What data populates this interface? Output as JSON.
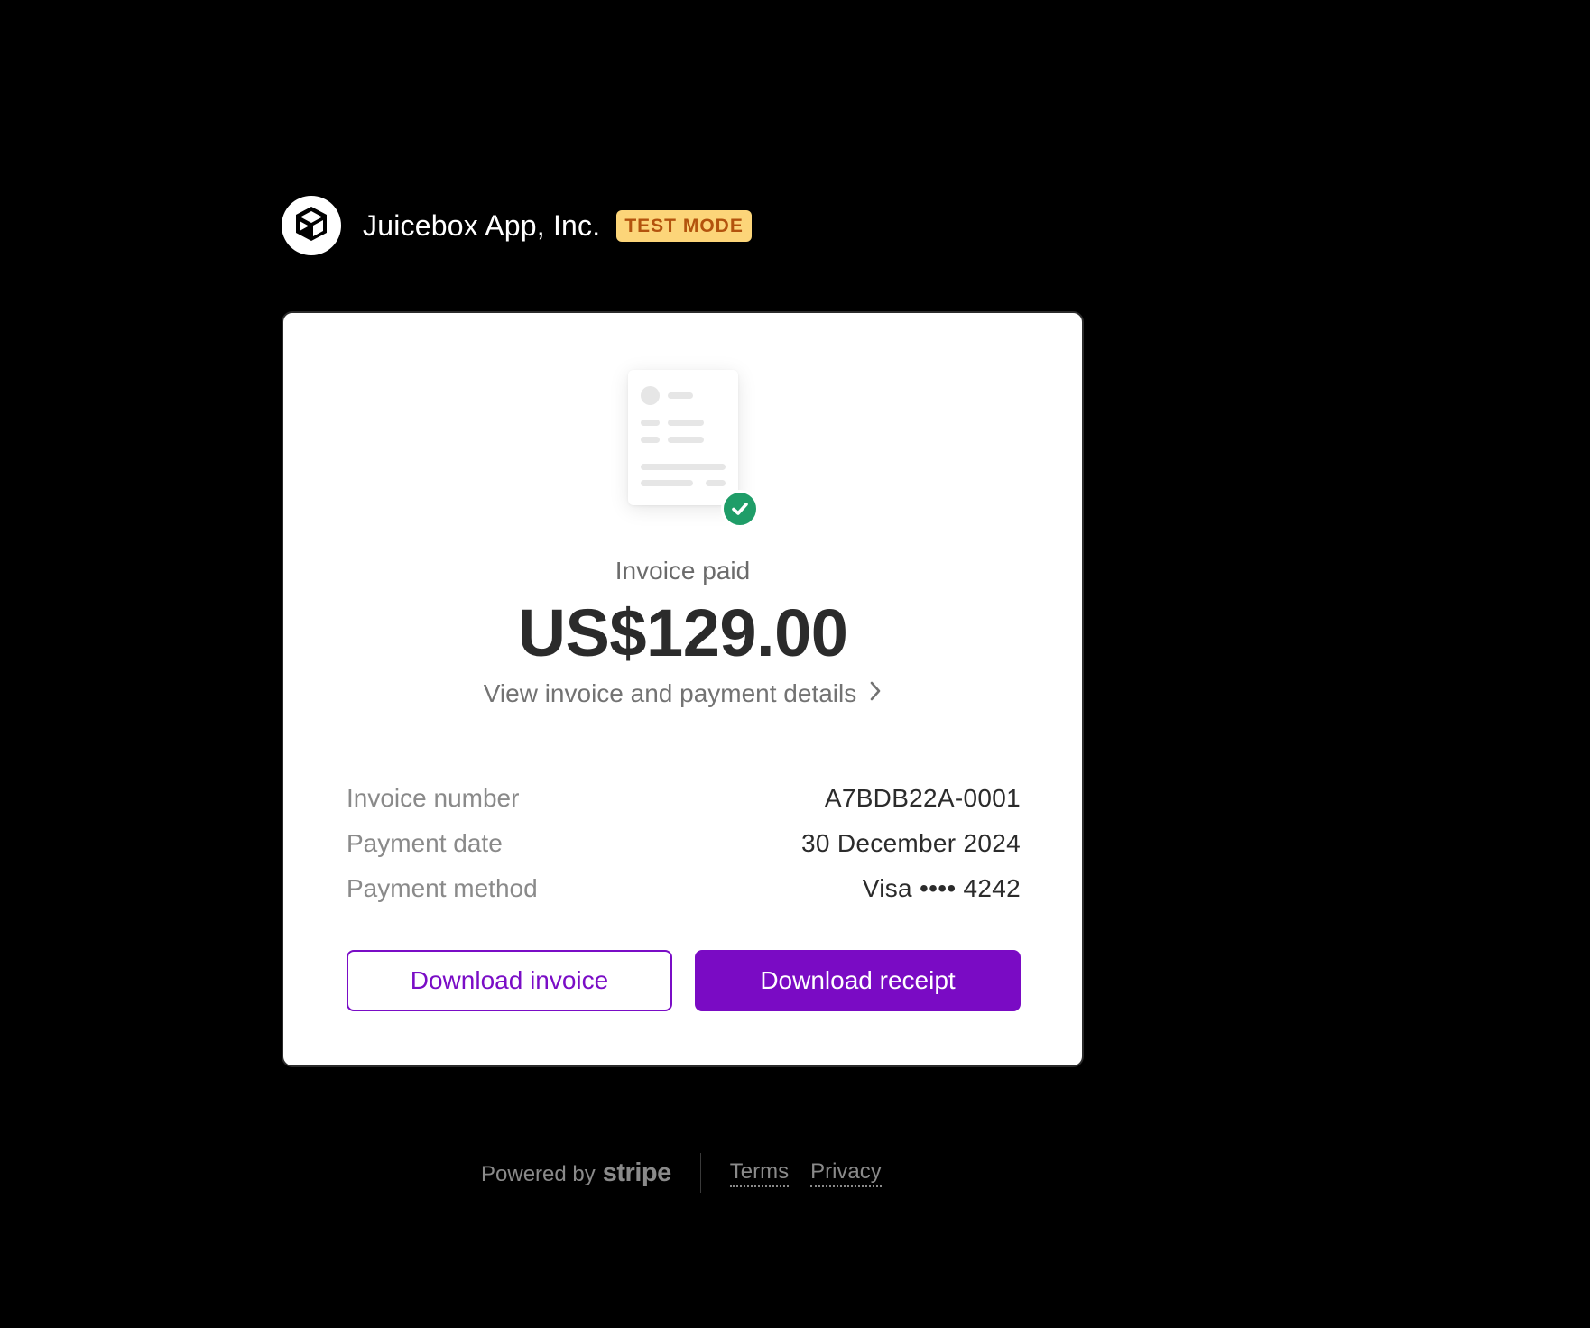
{
  "header": {
    "merchant_name": "Juicebox App, Inc.",
    "test_badge": "TEST MODE",
    "logo_icon": "cube-icon"
  },
  "card": {
    "status": "Invoice paid",
    "amount": "US$129.00",
    "details_link": "View invoice and payment details",
    "info": [
      {
        "label": "Invoice number",
        "value": "A7BDB22A-0001"
      },
      {
        "label": "Payment date",
        "value": "30 December 2024"
      },
      {
        "label": "Payment method",
        "value": "Visa •••• 4242"
      }
    ],
    "buttons": {
      "download_invoice": "Download invoice",
      "download_receipt": "Download receipt"
    }
  },
  "footer": {
    "powered_by": "Powered by",
    "brand": "stripe",
    "links": [
      "Terms",
      "Privacy"
    ]
  },
  "colors": {
    "accent": "#7a0bc4",
    "success": "#1f9d68",
    "badge_bg": "#fcd579",
    "badge_text": "#b3530d",
    "background": "#000000"
  }
}
